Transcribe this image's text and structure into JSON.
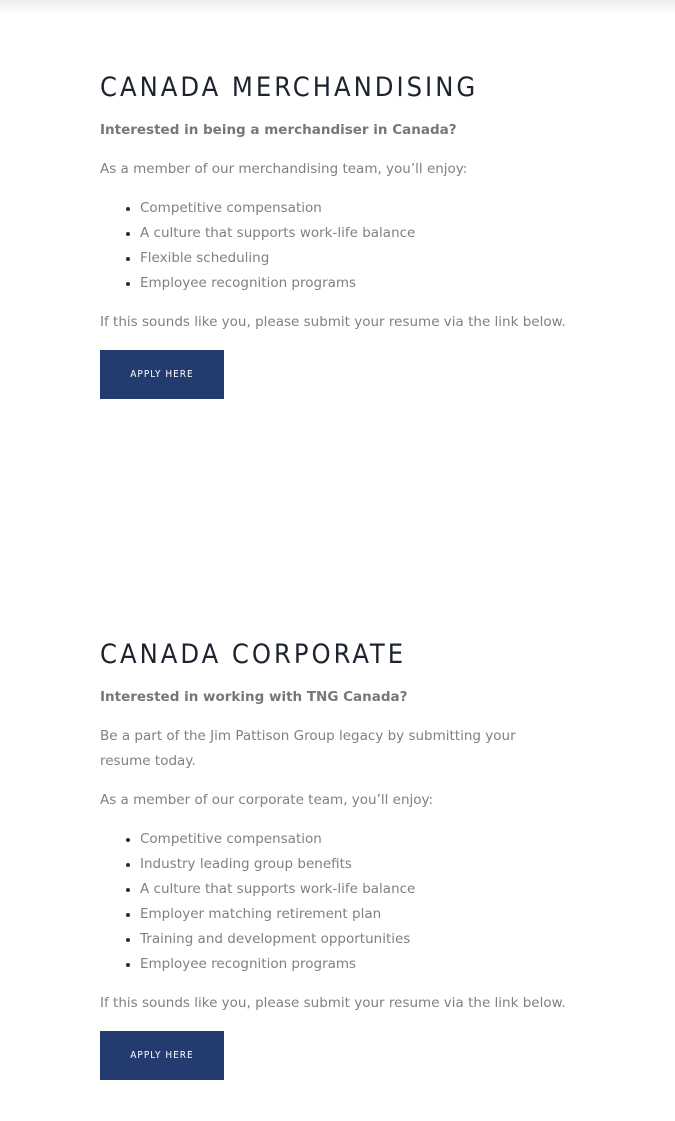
{
  "merchandising": {
    "title": "CANADA MERCHANDISING",
    "lead": "Interested in being a merchandiser in Canada?",
    "intro": "As a member of our merchandising team, you’ll enjoy:",
    "benefits": [
      "Competitive compensation",
      "A culture that supports work-life balance",
      "Flexible scheduling",
      "Employee recognition programs"
    ],
    "closing": "If this sounds like you, please submit your resume via the link below.",
    "button_label": "APPLY HERE"
  },
  "corporate": {
    "title": "CANADA CORPORATE",
    "lead": "Interested in working with TNG Canada?",
    "paragraph": "Be a part of the Jim Pattison Group legacy by submitting your resume today.",
    "intro": "As a member of our corporate team, you’ll enjoy:",
    "benefits": [
      "Competitive compensation",
      "Industry leading group benefits",
      "A culture that supports work-life balance",
      "Employer matching retirement plan",
      "Training and development opportunities",
      "Employee recognition programs"
    ],
    "closing": "If this sounds like you, please submit your resume via the link below.",
    "button_label": "APPLY HERE"
  },
  "colors": {
    "button_background": "#233b6e",
    "heading": "#1d2430",
    "body_text": "#808080"
  }
}
